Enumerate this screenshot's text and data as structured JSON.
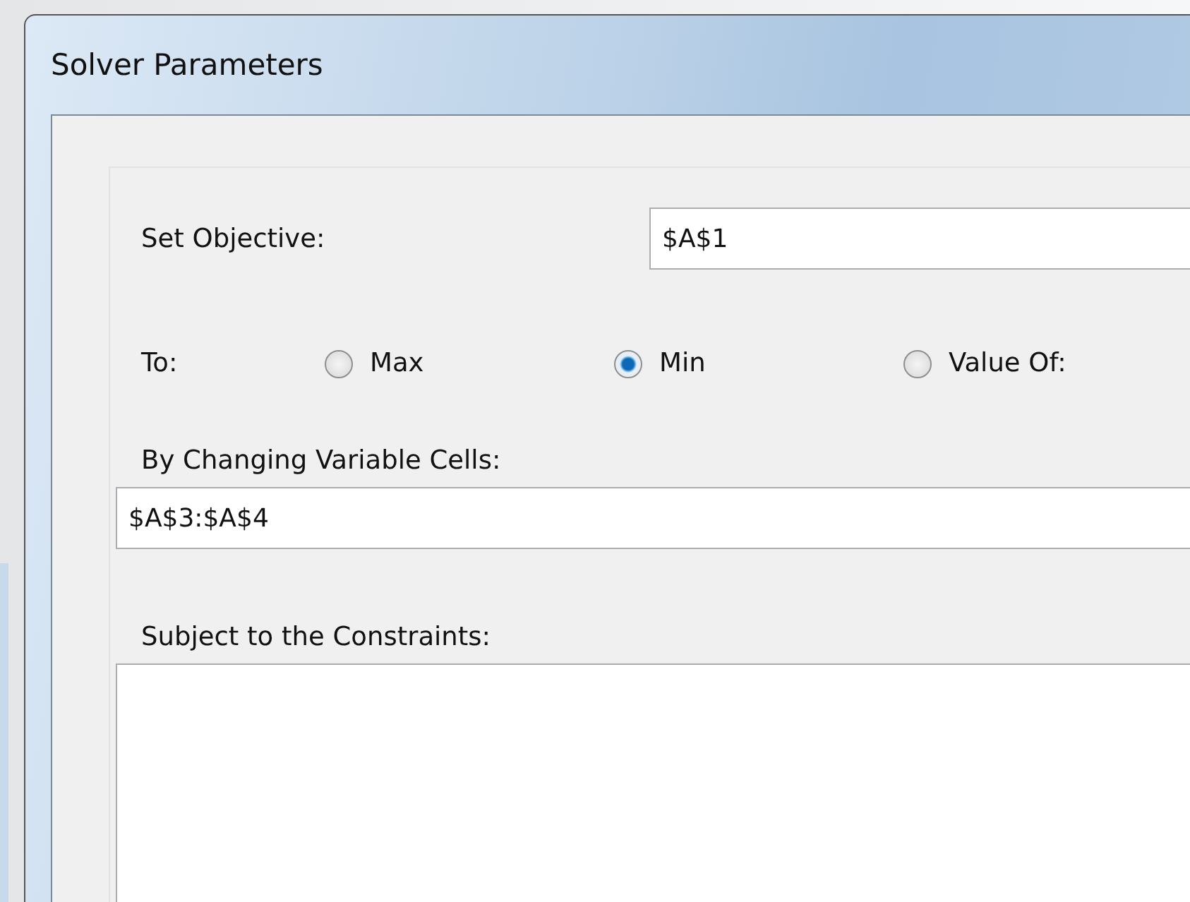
{
  "window": {
    "title": "Solver Parameters"
  },
  "objective": {
    "label": "Set Objective:",
    "value": "$A$1"
  },
  "to": {
    "label": "To:",
    "options": [
      {
        "label": "Max",
        "selected": false
      },
      {
        "label": "Min",
        "selected": true
      },
      {
        "label": "Value Of:",
        "selected": false
      }
    ]
  },
  "changing_cells": {
    "label": "By Changing Variable Cells:",
    "value": "$A$3:$A$4"
  },
  "constraints": {
    "label": "Subject to the Constraints:"
  }
}
